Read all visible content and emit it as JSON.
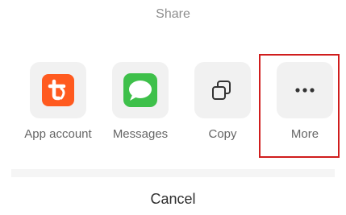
{
  "share_sheet": {
    "title": "Share",
    "targets": [
      {
        "label": "App account",
        "icon": "tuya-app-icon"
      },
      {
        "label": "Messages",
        "icon": "messages-icon"
      },
      {
        "label": "Copy",
        "icon": "copy-icon"
      },
      {
        "label": "More",
        "icon": "more-icon"
      }
    ],
    "cancel_label": "Cancel"
  },
  "colors": {
    "tile_background": "#f1f1f1",
    "tuya_orange": "#ff5a1f",
    "messages_green": "#3ec04a",
    "highlight_red": "#d01d1d"
  }
}
